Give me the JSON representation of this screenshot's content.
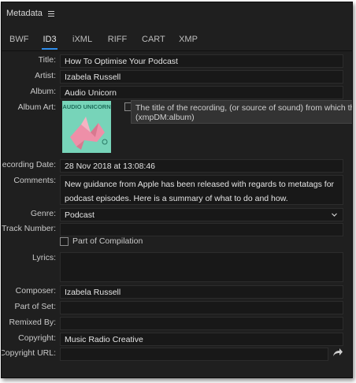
{
  "header": {
    "title": "Metadata"
  },
  "tabs": [
    "BWF",
    "ID3",
    "iXML",
    "RIFF",
    "CART",
    "XMP"
  ],
  "active_tab": "ID3",
  "fields": {
    "title": {
      "label": "Title:",
      "value": "How To Optimise Your Podcast"
    },
    "artist": {
      "label": "Artist:",
      "value": "Izabela Russell"
    },
    "album": {
      "label": "Album:",
      "value": "Audio Unicorn"
    },
    "album_art": {
      "label": "Album Art:",
      "text": "AUDIO UNICORN"
    },
    "recording_date": {
      "label": "Recording Date:",
      "value": "28 Nov 2018 at 13:08:46"
    },
    "comments": {
      "label": "Comments:",
      "value": "New guidance from Apple has been released with regards to metatags for podcast episodes. Here is a summary of what to do and how."
    },
    "genre": {
      "label": "Genre:",
      "value": "Podcast"
    },
    "track_number": {
      "label": "Track Number:",
      "value": ""
    },
    "compilation": {
      "label": "Part of Compilation",
      "checked": false
    },
    "lyrics": {
      "label": "Lyrics:",
      "value": ""
    },
    "composer": {
      "label": "Composer:",
      "value": "Izabela Russell"
    },
    "part_of_set": {
      "label": "Part of Set:",
      "value": ""
    },
    "remixed_by": {
      "label": "Remixed By:",
      "value": ""
    },
    "copyright": {
      "label": "Copyright:",
      "value": "Music Radio Creative"
    },
    "copyright_url": {
      "label": "Copyright URL:",
      "value": ""
    }
  },
  "tooltip": {
    "line1": "The title of the recording, (or source of sound) from which th",
    "line2": "(xmpDM:album)"
  },
  "colors": {
    "panel_bg": "#1f1f1f",
    "field_bg": "#181818",
    "accent": "#2d8ceb",
    "art_bg": "#7fd8bf",
    "art_unicorn": "#ee8fa8"
  }
}
